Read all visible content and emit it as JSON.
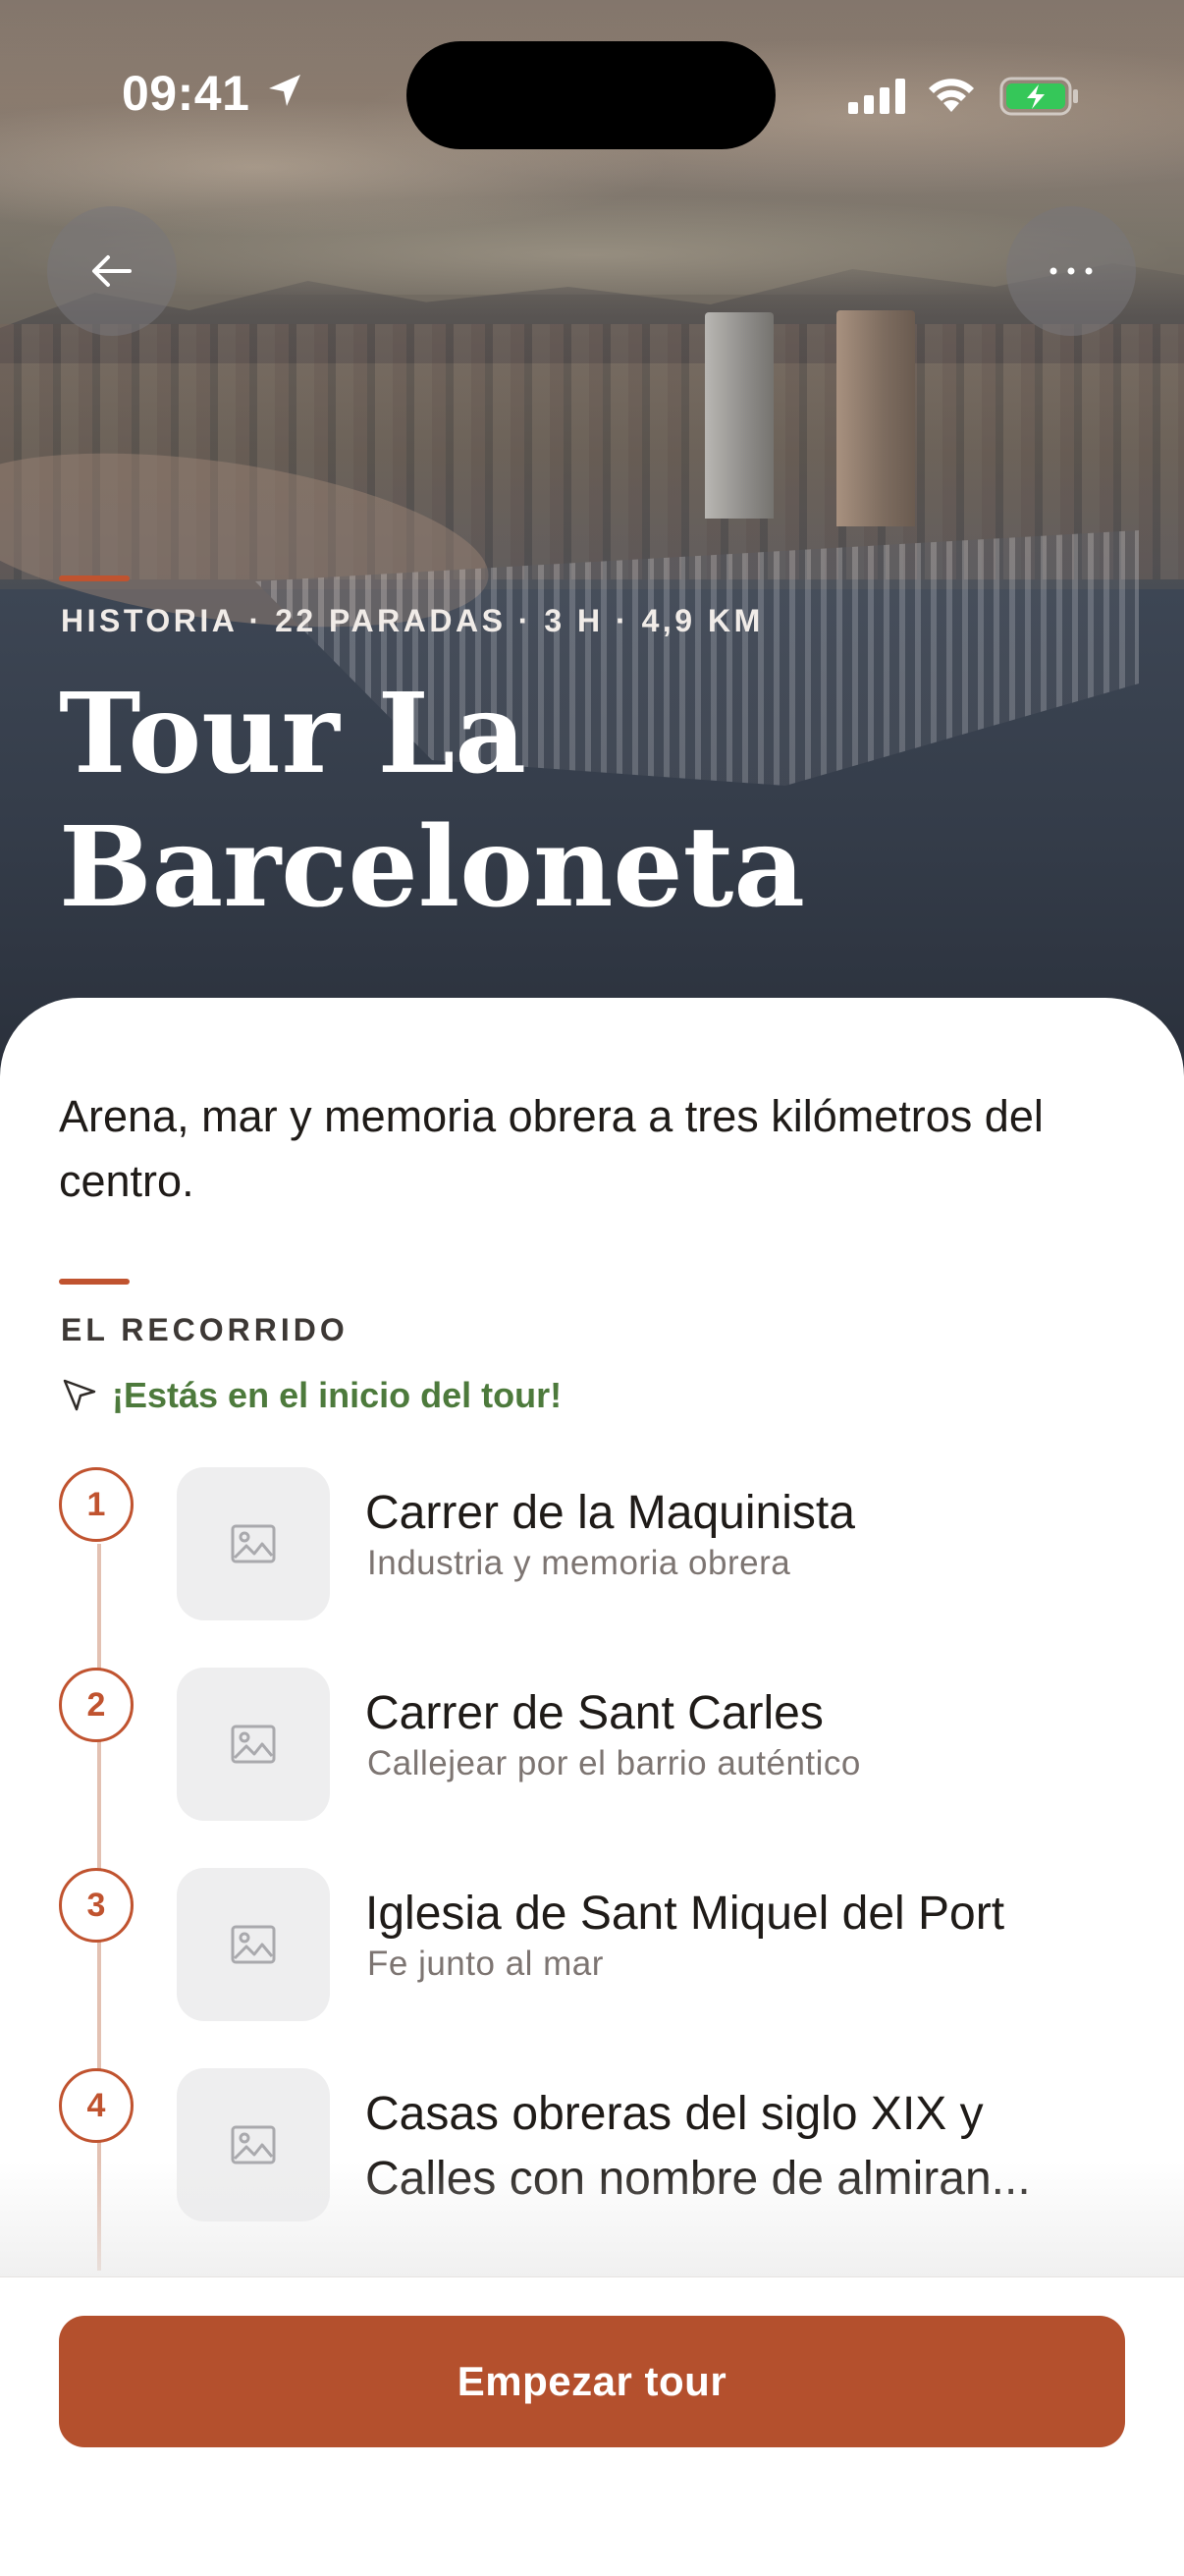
{
  "status_bar": {
    "time": "09:41"
  },
  "hero": {
    "meta": "HISTORIA · 22 PARADAS · 3 H · 4,9 KM",
    "title_line1": "Tour La",
    "title_line2": "Barceloneta"
  },
  "tagline": "Arena, mar y memoria obrera a tres kilómetros del centro.",
  "route": {
    "section_title": "EL RECORRIDO",
    "start_note": "¡Estás en el inicio del tour!",
    "stops": [
      {
        "number": "1",
        "title": "Carrer de la Maquinista",
        "subtitle": "Industria y memoria obrera"
      },
      {
        "number": "2",
        "title": "Carrer de Sant Carles",
        "subtitle": "Callejear por el barrio auténtico"
      },
      {
        "number": "3",
        "title": "Iglesia de Sant Miquel del Port",
        "subtitle": "Fe junto al mar"
      },
      {
        "number": "4",
        "title_line1": "Casas obreras del siglo XIX y",
        "title_line2": "Calles con nombre de almiran..."
      }
    ]
  },
  "cta": {
    "label": "Empezar tour"
  },
  "colors": {
    "accent": "#b4502d",
    "start_note": "#4d7a3c",
    "thumb_bg": "#eeeeef"
  }
}
